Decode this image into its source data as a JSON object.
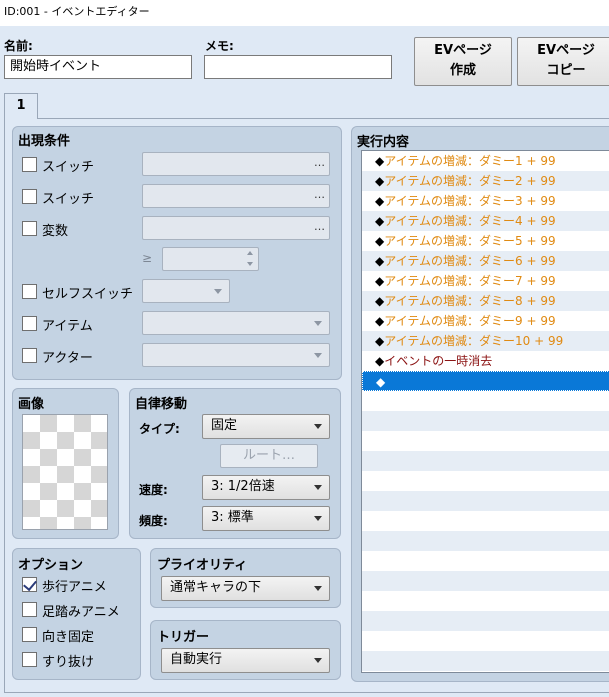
{
  "window": {
    "title": "ID:001 - イベントエディター"
  },
  "header": {
    "name_label": "名前:",
    "name_value": "開始時イベント",
    "memo_label": "メモ:",
    "memo_value": "",
    "ev_create_line1": "EVページ",
    "ev_create_line2": "作成",
    "ev_copy_line1": "EVページ",
    "ev_copy_line2": "コピー"
  },
  "tabs": [
    {
      "label": "1"
    }
  ],
  "conditions": {
    "title": "出現条件",
    "switch1_label": "スイッチ",
    "switch2_label": "スイッチ",
    "variable_label": "変数",
    "self_switch_label": "セルフスイッチ",
    "item_label": "アイテム",
    "actor_label": "アクター",
    "dots": "…",
    "gte_symbol": "≥"
  },
  "image": {
    "title": "画像"
  },
  "movement": {
    "title": "自律移動",
    "type_label": "タイプ:",
    "type_value": "固定",
    "route_button": "ルート…",
    "speed_label": "速度:",
    "speed_value": "3: 1/2倍速",
    "freq_label": "頻度:",
    "freq_value": "3: 標準"
  },
  "options": {
    "title": "オプション",
    "walking_anim": "歩行アニメ",
    "stepping_anim": "足踏みアニメ",
    "direction_fix": "向き固定",
    "through": "すり抜け"
  },
  "priority": {
    "title": "プライオリティ",
    "value": "通常キャラの下"
  },
  "trigger": {
    "title": "トリガー",
    "value": "自動実行"
  },
  "contents": {
    "title": "実行内容",
    "diamond": "◆",
    "commands": [
      "アイテムの増減：ダミー1 + 99",
      "アイテムの増減：ダミー2 + 99",
      "アイテムの増減：ダミー3 + 99",
      "アイテムの増減：ダミー4 + 99",
      "アイテムの増減：ダミー5 + 99",
      "アイテムの増減：ダミー6 + 99",
      "アイテムの増減：ダミー7 + 99",
      "アイテムの増減：ダミー8 + 99",
      "アイテムの増減：ダミー9 + 99",
      "アイテムの増減：ダミー10 + 99",
      "イベントの一時消去"
    ]
  },
  "colors": {
    "command_orange": "#e08a12",
    "command_red": "#8a1010",
    "selection_blue": "#0a78d7"
  }
}
